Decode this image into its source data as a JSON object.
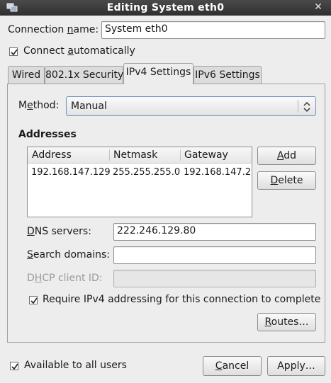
{
  "window": {
    "title": "Editing System eth0",
    "close_glyph": "✕"
  },
  "connection": {
    "name_label_pre": "Connection ",
    "name_label_u": "n",
    "name_label_post": "ame:",
    "name_value": "System eth0",
    "auto_label_pre": "Connect ",
    "auto_label_u": "a",
    "auto_label_post": "utomatically",
    "auto_checked": true
  },
  "tabs": [
    {
      "label": "Wired"
    },
    {
      "label": "802.1x Security"
    },
    {
      "label": "IPv4 Settings",
      "active": true
    },
    {
      "label": "IPv6 Settings"
    }
  ],
  "ipv4": {
    "method_label_pre": "M",
    "method_label_u": "e",
    "method_label_post": "thod:",
    "method_value": "Manual",
    "addresses_heading": "Addresses",
    "table": {
      "headers": [
        "Address",
        "Netmask",
        "Gateway"
      ],
      "rows": [
        [
          "192.168.147.129",
          "255.255.255.0",
          "192.168.147.2"
        ]
      ]
    },
    "add_label_u": "A",
    "add_label_post": "dd",
    "delete_label_u": "D",
    "delete_label_post": "elete",
    "dns_label_u": "D",
    "dns_label_post": "NS servers:",
    "dns_value": "222.246.129.80",
    "search_label_u": "S",
    "search_label_post": "earch domains:",
    "search_value": "",
    "dhcp_label_pre": "D",
    "dhcp_label_u": "H",
    "dhcp_label_post": "CP client ID:",
    "dhcp_value": "",
    "require_label": "Require IPv4 addressing for this connection to complete",
    "require_checked": true,
    "routes_label_u": "R",
    "routes_label_post": "outes…"
  },
  "footer": {
    "available_label": "Available to all users",
    "available_checked": true,
    "cancel_label_u": "C",
    "cancel_label_post": "ancel",
    "apply_label": "Apply…"
  }
}
